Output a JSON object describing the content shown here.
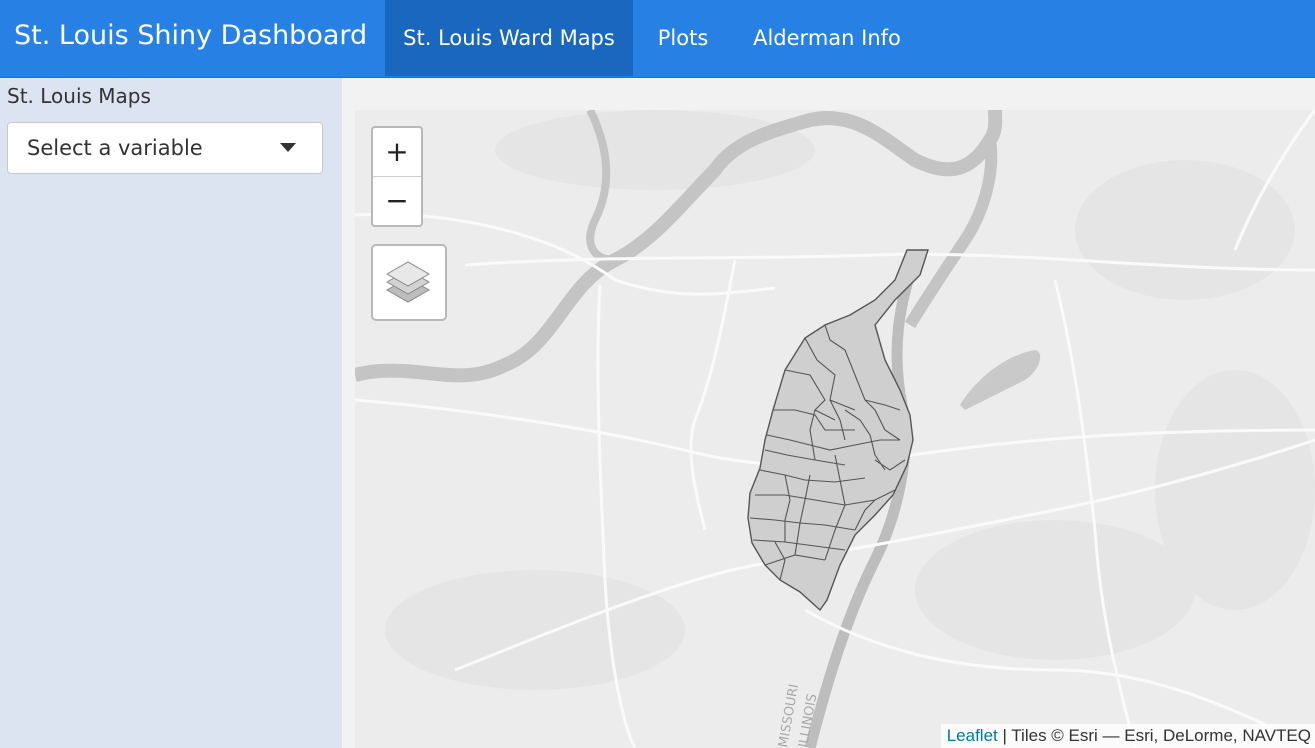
{
  "header": {
    "brand": "St. Louis Shiny Dashboard",
    "tabs": [
      {
        "label": "St. Louis Ward Maps",
        "active": true
      },
      {
        "label": "Plots",
        "active": false
      },
      {
        "label": "Alderman Info",
        "active": false
      }
    ]
  },
  "sidebar": {
    "title": "St. Louis Maps",
    "select": {
      "value": "Select a variable"
    }
  },
  "map": {
    "zoom_in": "+",
    "zoom_out": "−",
    "attribution": {
      "link": "Leaflet",
      "text": " | Tiles © Esri — Esri, DeLorme, NAVTEQ"
    },
    "labels": {
      "river_left": "MISSOURI",
      "river_right": "ILLINOIS"
    }
  },
  "colors": {
    "navbar": "#2780e3",
    "navbar_active": "#1967be",
    "sidebar": "#dce4f2",
    "ward_fill": "#cfcfcf"
  }
}
